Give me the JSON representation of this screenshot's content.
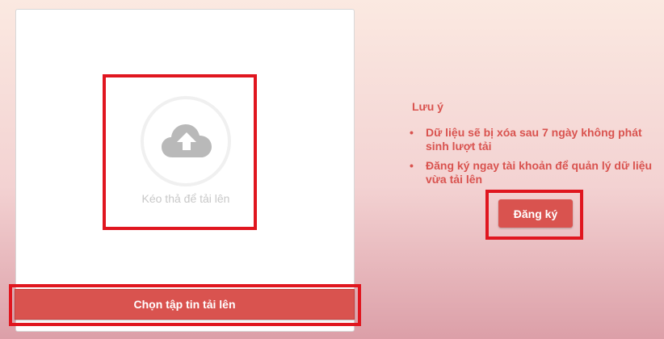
{
  "upload": {
    "drop_text": "Kéo thả để tải lên",
    "choose_label": "Chọn tập tin tải lên",
    "icon": "cloud-upload-icon"
  },
  "note": {
    "title": "Lưu ý",
    "bullet": "•",
    "items": [
      {
        "text": "Dữ liệu sẽ bị xóa sau 7 ngày không phát sinh lượt tải"
      },
      {
        "text": "Đăng ký ngay tài khoản để quản lý dữ liệu vừa tải lên"
      }
    ]
  },
  "register": {
    "label": "Đăng ký"
  },
  "colors": {
    "accent": "#d9534f",
    "highlight": "#e0161f",
    "icon_gray": "#b9b9b9"
  }
}
